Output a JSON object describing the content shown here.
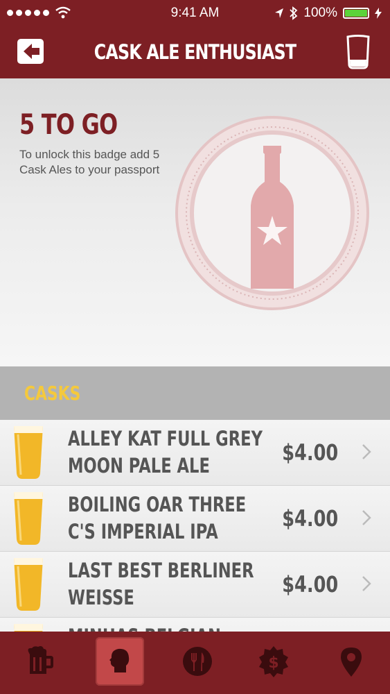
{
  "status_bar": {
    "time": "9:41 AM",
    "battery": "100%"
  },
  "nav": {
    "title": "CASK ALE ENTHUSIAST",
    "back_icon": "back-arrow-icon",
    "right_icon": "pint-glass-icon"
  },
  "badge": {
    "remaining": "5 TO GO",
    "description": "To unlock this badge add 5 Cask Ales to your passport",
    "icon": "beer-bottle-star-icon"
  },
  "section": {
    "title": "CASKS"
  },
  "casks": [
    {
      "name": "ALLEY KAT FULL GREY MOON PALE ALE",
      "price": "$4.00"
    },
    {
      "name": "BOILING OAR THREE C'S IMPERIAL IPA",
      "price": "$4.00"
    },
    {
      "name": "LAST BEST BERLINER WEISSE",
      "price": "$4.00"
    },
    {
      "name": "MINHAS BELGIAN WHITE",
      "price": ""
    }
  ],
  "tabs": [
    {
      "name": "beer-mug-icon",
      "active": false
    },
    {
      "name": "profile-head-icon",
      "active": true
    },
    {
      "name": "fork-knife-icon",
      "active": false
    },
    {
      "name": "dollar-badge-icon",
      "active": false
    },
    {
      "name": "location-pin-icon",
      "active": false
    }
  ],
  "colors": {
    "brand": "#7d1f24",
    "accent": "#f5c93c",
    "active_tab": "#c24849"
  }
}
